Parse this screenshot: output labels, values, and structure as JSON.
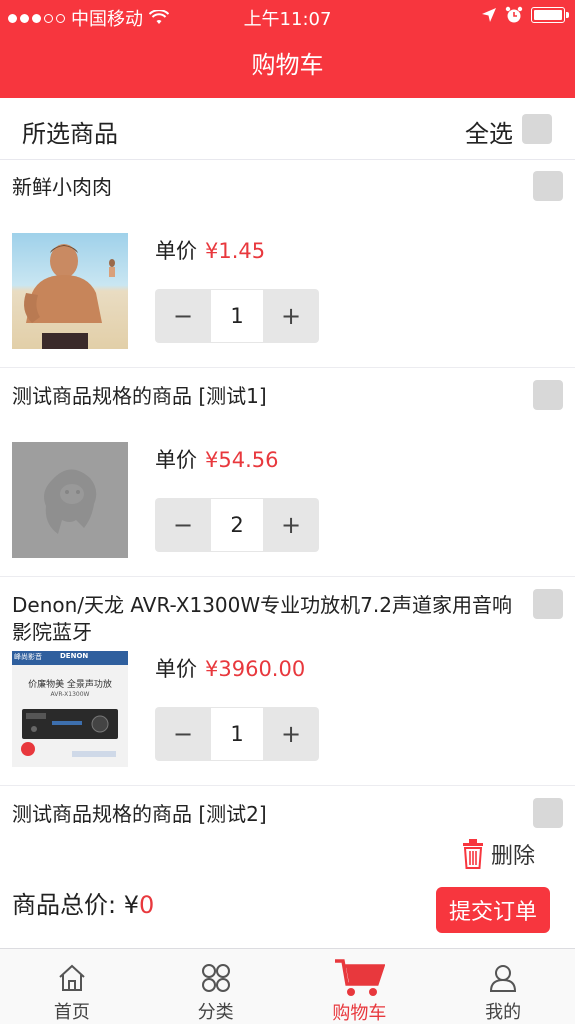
{
  "status_bar": {
    "carrier": "中国移动",
    "time": "上午11:07"
  },
  "nav": {
    "title": "购物车"
  },
  "select_header": {
    "title": "所选商品",
    "select_all": "全选"
  },
  "price_label": "单价",
  "items": [
    {
      "name": "新鲜小肉肉",
      "price": "¥1.45",
      "quantity": "1"
    },
    {
      "name": "测试商品规格的商品 [测试1]",
      "price": "¥54.56",
      "quantity": "2"
    },
    {
      "name": "Denon/天龙 AVR-X1300W专业功放机7.2声道家用音响影院蓝牙",
      "price": "¥3960.00",
      "quantity": "1"
    },
    {
      "name": "测试商品规格的商品 [测试2]"
    }
  ],
  "product3_image": {
    "banner_left": "峰尚影音",
    "banner_brand": "DENON",
    "headline": "价廉物美 全景声功放",
    "model": "AVR-X1300W"
  },
  "bottom": {
    "delete_label": "删除",
    "total_label": "商品总价: ¥",
    "total_value": "0",
    "submit_label": "提交订单"
  },
  "tabs": [
    {
      "label": "首页",
      "icon": "home-icon"
    },
    {
      "label": "分类",
      "icon": "category-icon"
    },
    {
      "label": "购物车",
      "icon": "cart-icon",
      "active": true
    },
    {
      "label": "我的",
      "icon": "user-icon"
    }
  ],
  "colors": {
    "brand_red": "#f7363e",
    "price_red": "#e8383d",
    "checkbox_gray": "#d8d8d8"
  }
}
